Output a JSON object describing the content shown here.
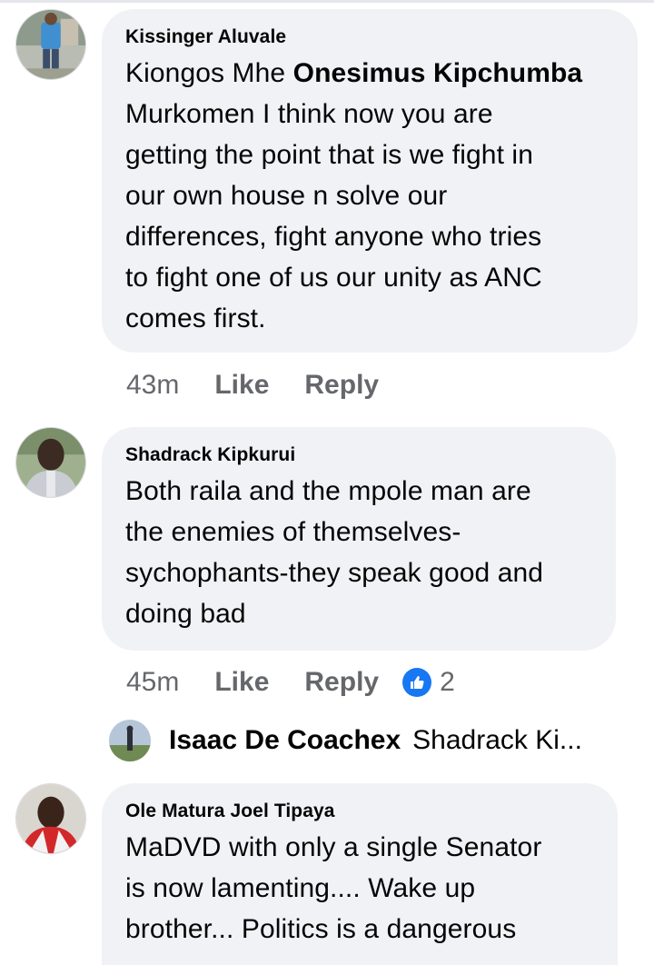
{
  "comments": [
    {
      "author": "Kissinger Aluvale",
      "text_lines": [
        "Kiongos Mhe ",
        "Murkomen I think now you are",
        "getting the point that is we fight in",
        "our own house n solve our",
        "differences, fight anyone who tries",
        "to fight one of us our unity as ANC",
        "comes first."
      ],
      "mention": "Onesimus Kipchumba",
      "time": "43m",
      "like_label": "Like",
      "reply_label": "Reply"
    },
    {
      "author": "Shadrack Kipkurui",
      "text_lines": [
        "Both raila and the mpole man are",
        "the enemies of themselves-",
        "sychophants-they speak good and",
        "doing bad"
      ],
      "time": "45m",
      "like_label": "Like",
      "reply_label": "Reply",
      "reaction": {
        "icon": "thumbs-up-icon",
        "count": "2",
        "color": "#1877f2"
      },
      "reply_preview": {
        "name": "Isaac De Coachex",
        "snippet": "Shadrack Ki..."
      }
    },
    {
      "author": "Ole Matura Joel Tipaya",
      "text_lines": [
        "MaDVD with only a single Senator",
        "is now lamenting.... Wake up",
        "brother... Politics is a dangerous"
      ]
    }
  ],
  "colors": {
    "bubble": "#f0f2f5",
    "meta_text": "#65676b",
    "accent": "#1877f2"
  }
}
